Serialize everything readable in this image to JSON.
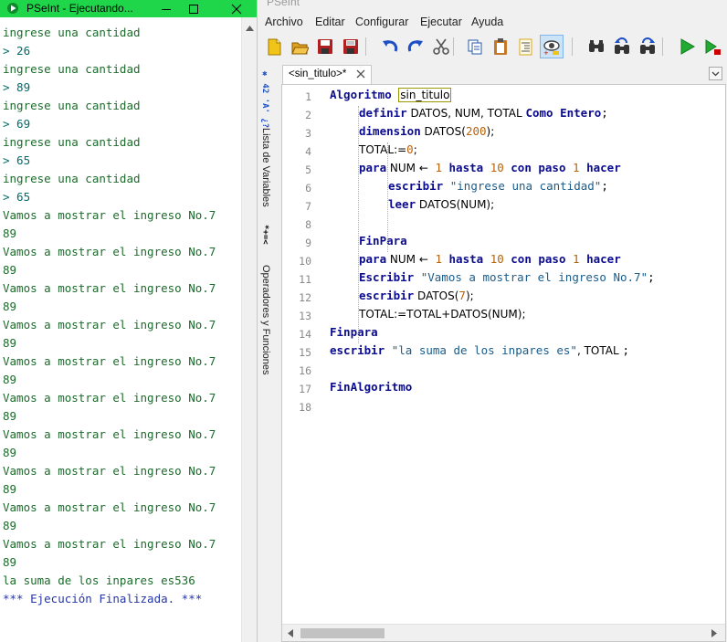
{
  "console": {
    "title": "PSeInt - Ejecutando...",
    "lines": [
      {
        "text": "ingrese una cantidad",
        "kind": "out"
      },
      {
        "text": "> 26",
        "kind": "in"
      },
      {
        "text": "ingrese una cantidad",
        "kind": "out"
      },
      {
        "text": "> 89",
        "kind": "in"
      },
      {
        "text": "ingrese una cantidad",
        "kind": "out"
      },
      {
        "text": "> 69",
        "kind": "in"
      },
      {
        "text": "ingrese una cantidad",
        "kind": "out"
      },
      {
        "text": "> 65",
        "kind": "in"
      },
      {
        "text": "ingrese una cantidad",
        "kind": "out"
      },
      {
        "text": "> 65",
        "kind": "in"
      },
      {
        "text": "Vamos a mostrar el ingreso No.7",
        "kind": "out"
      },
      {
        "text": "89",
        "kind": "out"
      },
      {
        "text": "Vamos a mostrar el ingreso No.7",
        "kind": "out"
      },
      {
        "text": "89",
        "kind": "out"
      },
      {
        "text": "Vamos a mostrar el ingreso No.7",
        "kind": "out"
      },
      {
        "text": "89",
        "kind": "out"
      },
      {
        "text": "Vamos a mostrar el ingreso No.7",
        "kind": "out"
      },
      {
        "text": "89",
        "kind": "out"
      },
      {
        "text": "Vamos a mostrar el ingreso No.7",
        "kind": "out"
      },
      {
        "text": "89",
        "kind": "out"
      },
      {
        "text": "Vamos a mostrar el ingreso No.7",
        "kind": "out"
      },
      {
        "text": "89",
        "kind": "out"
      },
      {
        "text": "Vamos a mostrar el ingreso No.7",
        "kind": "out"
      },
      {
        "text": "89",
        "kind": "out"
      },
      {
        "text": "Vamos a mostrar el ingreso No.7",
        "kind": "out"
      },
      {
        "text": "89",
        "kind": "out"
      },
      {
        "text": "Vamos a mostrar el ingreso No.7",
        "kind": "out"
      },
      {
        "text": "89",
        "kind": "out"
      },
      {
        "text": "Vamos a mostrar el ingreso No.7",
        "kind": "out"
      },
      {
        "text": "89",
        "kind": "out"
      },
      {
        "text": "la suma de los inpares es536",
        "kind": "out"
      },
      {
        "text": "*** Ejecución Finalizada. ***",
        "kind": "sys"
      }
    ]
  },
  "main": {
    "title": "PSeInt",
    "menu": [
      "Archivo",
      "Editar",
      "Configurar",
      "Ejecutar",
      "Ayuda"
    ],
    "toolbar": [
      {
        "name": "new-file-icon",
        "color": "#f0c419"
      },
      {
        "name": "open-folder-icon",
        "color": "#e0a020"
      },
      {
        "name": "save-icon",
        "color": "#b02020"
      },
      {
        "name": "save-as-icon",
        "color": "#b02020"
      },
      {
        "name": "undo-icon",
        "color": "#1c4fc4"
      },
      {
        "name": "redo-icon",
        "color": "#1c4fc4"
      },
      {
        "name": "cut-icon",
        "color": "#555555"
      },
      {
        "name": "copy-icon",
        "color": "#2a5aa8"
      },
      {
        "name": "paste-icon",
        "color": "#c27a2a"
      },
      {
        "name": "indent-icon",
        "color": "#d8a81a"
      },
      {
        "name": "inspect-icon",
        "color": "#444444"
      },
      {
        "name": "find-icon",
        "color": "#333333"
      },
      {
        "name": "find-previous-icon",
        "color": "#333333"
      },
      {
        "name": "find-next-icon",
        "color": "#333333"
      },
      {
        "name": "run-icon",
        "color": "#22aa33"
      },
      {
        "name": "step-run-icon",
        "color": "#22aa33"
      }
    ],
    "side_tabs": {
      "variables": "Lista de Variables",
      "operators": "Operadores y Funciones"
    },
    "tab": {
      "label": "<sin_titulo>*"
    },
    "code_lines": [
      {
        "n": 1,
        "indent": 0,
        "parts": [
          [
            "kw",
            "Algoritmo"
          ],
          [
            "t",
            " "
          ],
          [
            "box",
            "sin_titulo"
          ]
        ]
      },
      {
        "n": 2,
        "indent": 1,
        "parts": [
          [
            "kw",
            "definir"
          ],
          [
            "id",
            " DATOS, NUM, TOTAL "
          ],
          [
            "kw",
            "Como Entero"
          ],
          [
            "t",
            ";"
          ]
        ]
      },
      {
        "n": 3,
        "indent": 1,
        "parts": [
          [
            "kw",
            "dimension"
          ],
          [
            "id",
            " DATOS("
          ],
          [
            "num",
            "200"
          ],
          [
            "id",
            ");"
          ]
        ]
      },
      {
        "n": 4,
        "indent": 1,
        "parts": [
          [
            "id",
            "TOTAL:="
          ],
          [
            "num",
            "0"
          ],
          [
            "id",
            ";"
          ]
        ]
      },
      {
        "n": 5,
        "indent": 1,
        "parts": [
          [
            "kw",
            "para"
          ],
          [
            "id",
            " NUM "
          ],
          [
            "op",
            "←"
          ],
          [
            "t",
            " "
          ],
          [
            "num",
            "1"
          ],
          [
            "t",
            " "
          ],
          [
            "kw",
            "hasta"
          ],
          [
            "t",
            " "
          ],
          [
            "num",
            "10"
          ],
          [
            "t",
            " "
          ],
          [
            "kw",
            "con paso"
          ],
          [
            "t",
            " "
          ],
          [
            "num",
            "1"
          ],
          [
            "t",
            " "
          ],
          [
            "kw",
            "hacer"
          ]
        ]
      },
      {
        "n": 6,
        "indent": 2,
        "parts": [
          [
            "kw",
            "escribir"
          ],
          [
            "t",
            " "
          ],
          [
            "str",
            "\"ingrese una cantidad\""
          ],
          [
            "t",
            ";"
          ]
        ]
      },
      {
        "n": 7,
        "indent": 2,
        "parts": [
          [
            "kw",
            "leer"
          ],
          [
            "id",
            " DATOS(NUM);"
          ]
        ]
      },
      {
        "n": 8,
        "indent": 2,
        "parts": []
      },
      {
        "n": 9,
        "indent": 1,
        "parts": [
          [
            "kw",
            "FinPara"
          ]
        ]
      },
      {
        "n": 10,
        "indent": 1,
        "parts": [
          [
            "kw",
            "para"
          ],
          [
            "id",
            " NUM "
          ],
          [
            "op",
            "←"
          ],
          [
            "t",
            " "
          ],
          [
            "num",
            "1"
          ],
          [
            "t",
            " "
          ],
          [
            "kw",
            "hasta"
          ],
          [
            "t",
            " "
          ],
          [
            "num",
            "10"
          ],
          [
            "t",
            " "
          ],
          [
            "kw",
            "con paso"
          ],
          [
            "t",
            " "
          ],
          [
            "num",
            "1"
          ],
          [
            "t",
            " "
          ],
          [
            "kw",
            "hacer"
          ]
        ]
      },
      {
        "n": 11,
        "indent": 1,
        "parts": [
          [
            "kw",
            "Escribir"
          ],
          [
            "t",
            " "
          ],
          [
            "str",
            "\"Vamos a mostrar el ingreso No.7\""
          ],
          [
            "t",
            ";"
          ]
        ]
      },
      {
        "n": 12,
        "indent": 1,
        "parts": [
          [
            "kw",
            "escribir"
          ],
          [
            "id",
            " DATOS("
          ],
          [
            "num",
            "7"
          ],
          [
            "id",
            ");"
          ]
        ]
      },
      {
        "n": 13,
        "indent": 1,
        "parts": [
          [
            "id",
            "TOTAL:=TOTAL+DATOS(NUM);"
          ]
        ]
      },
      {
        "n": 14,
        "indent": 0,
        "parts": [
          [
            "kw",
            "Finpara"
          ]
        ]
      },
      {
        "n": 15,
        "indent": 0,
        "parts": [
          [
            "kw",
            "escribir"
          ],
          [
            "t",
            " "
          ],
          [
            "str",
            "\"la suma de los inpares es\""
          ],
          [
            "id",
            ", TOTAL "
          ],
          [
            "t",
            ";"
          ]
        ]
      },
      {
        "n": 16,
        "indent": 0,
        "parts": []
      },
      {
        "n": 17,
        "indent": 0,
        "parts": [
          [
            "kw",
            "FinAlgoritmo"
          ]
        ]
      },
      {
        "n": 18,
        "indent": 0,
        "parts": []
      }
    ]
  }
}
